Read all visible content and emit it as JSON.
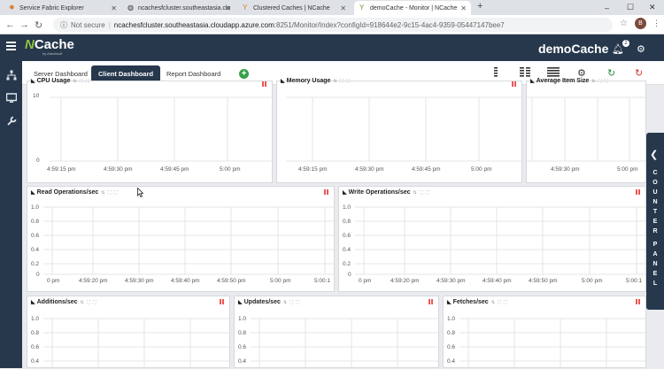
{
  "browser": {
    "tabs": [
      {
        "title": "Service Fabric Explorer"
      },
      {
        "title": "ncachesfcluster.southeastasia.clo"
      },
      {
        "title": "Clustered Caches | NCache"
      },
      {
        "title": "demoCache - Monitor | NCache"
      }
    ],
    "new_tab": "+",
    "minimize": "–",
    "maximize": "☐",
    "close": "✕",
    "not_secure": "Not secure",
    "url_host": "ncachesfcluster.southeastasia.cloudapp.azure.com",
    "url_path": ":8251/Monitor/Index?configId=918644e2-9c15-4ac4-9359-05447147bee7",
    "profile_initial": "B"
  },
  "app": {
    "logo_n": "N",
    "logo_text": "Cache",
    "logo_sub": "by Alachisoft",
    "cache_name": "demoCache",
    "notification_count": "2"
  },
  "tabs": {
    "server": "Server Dashboard",
    "client": "Client Dashboard",
    "report": "Report Dashboard",
    "add": "+"
  },
  "counter_panel": {
    "letters": [
      "C",
      "O",
      "U",
      "N",
      "T",
      "E",
      "R",
      " ",
      "P",
      "A",
      "N",
      "E",
      "L"
    ]
  },
  "panels": {
    "cpu": {
      "title": "CPU Usage",
      "y_ticks": [
        "10",
        "0"
      ],
      "x_ticks": [
        "4:59:15 pm",
        "4:59:30 pm",
        "4:59:45 pm",
        "5:00 pm"
      ]
    },
    "memory": {
      "title": "Memory Usage",
      "x_ticks": [
        "4:59:15 pm",
        "4:59:30 pm",
        "4:59:45 pm",
        "5:00 pm"
      ]
    },
    "item": {
      "title": "Average Item Size",
      "x_ticks": [
        "4:59:30 pm",
        "5:00 pm"
      ]
    },
    "read": {
      "title": "Read Operations/sec",
      "y_ticks": [
        "1.0",
        "0.8",
        "0.6",
        "0.4",
        "0.2",
        "0"
      ],
      "x_ticks": [
        "0 pm",
        "4:59:20 pm",
        "4:59:30 pm",
        "4:59:40 pm",
        "4:59:50 pm",
        "5:00 pm",
        "5:00:1"
      ]
    },
    "write": {
      "title": "Write Operations/sec",
      "y_ticks": [
        "1.0",
        "0.8",
        "0.6",
        "0.4",
        "0.2",
        "0"
      ],
      "x_ticks": [
        "0 pm",
        "4:59:20 pm",
        "4:59:30 pm",
        "4:59:40 pm",
        "4:59:50 pm",
        "5:00 pm",
        "5:00:1"
      ]
    },
    "additions": {
      "title": "Additions/sec",
      "y_ticks": [
        "1.0",
        "0.8",
        "0.6",
        "0.4"
      ]
    },
    "updates": {
      "title": "Updates/sec",
      "y_ticks": [
        "1.0",
        "0.8",
        "0.6",
        "0.4"
      ]
    },
    "fetches": {
      "title": "Fetches/sec",
      "y_ticks": [
        "1.0",
        "0.8",
        "0.6",
        "0.4"
      ]
    }
  }
}
